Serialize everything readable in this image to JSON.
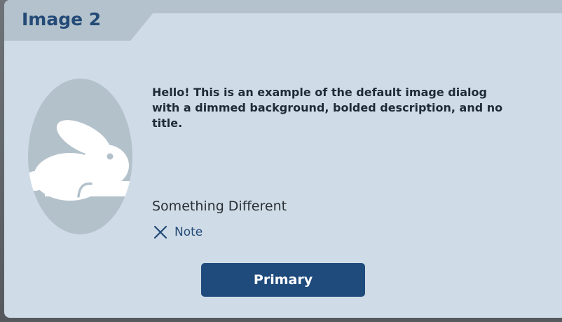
{
  "dialog": {
    "title": "Image 2",
    "description": "Hello! This is an example of the default image dialog with a dimmed background, bolded description, and no title.",
    "subheading": "Something Different",
    "note_label": "Note",
    "primary_label": "Primary",
    "image_icon": "rabbit-icon",
    "note_icon": "close-icon"
  },
  "colors": {
    "accent": "#1f4a7c",
    "title": "#244a77",
    "dialog_background": "#cfdce7",
    "tab_background": "#b3c2cc"
  }
}
